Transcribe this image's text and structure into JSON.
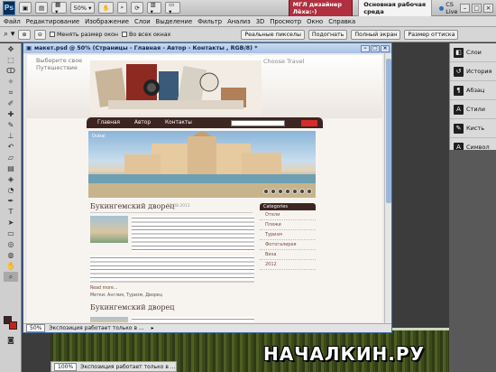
{
  "appbar": {
    "logo": "Ps",
    "zoom_value": "50%",
    "workspace_badge": "МГЛ дизайнер Лёха:-)",
    "workspace_main": "Основная рабочая среда",
    "cs_live": "CS Live",
    "minimize": "–",
    "maximize": "□",
    "close": "×"
  },
  "menu": [
    "Файл",
    "Редактирование",
    "Изображение",
    "Слои",
    "Выделение",
    "Фильтр",
    "Анализ",
    "3D",
    "Просмотр",
    "Окно",
    "Справка"
  ],
  "options": {
    "resize_windows": "Менять размер окон",
    "all_windows": "Во всех окнах",
    "actual_pixels": "Реальные пикселы",
    "fit": "Подогнать",
    "fill_screen": "Полный экран",
    "print_size": "Размер оттиска"
  },
  "panels": [
    {
      "icon": "layers-icon",
      "glyph": "◧",
      "label": "Слои"
    },
    {
      "icon": "history-icon",
      "glyph": "↺",
      "label": "История"
    },
    {
      "icon": "paragraph-icon",
      "glyph": "¶",
      "label": "Абзац"
    },
    {
      "icon": "styles-icon",
      "glyph": "A",
      "label": "Стили"
    },
    {
      "icon": "brush-icon",
      "glyph": "✎",
      "label": "Кисть"
    },
    {
      "icon": "character-icon",
      "glyph": "A",
      "label": "Символ"
    }
  ],
  "document": {
    "title": "макет.psd @ 50% (Страницы - Главная - Автор - Контакты , RGB/8) *",
    "zoom": "50%",
    "status": "Экспозиция работает только в ..."
  },
  "website": {
    "tagline": "Выберите свое Путешествие",
    "brand": "Choose Travel",
    "nav": [
      "Главная",
      "Автор",
      "Контакты"
    ],
    "hero_label": "Dubai",
    "heading": "Букингемский дворец",
    "date": "12.08.2012",
    "categories_title": "Categories",
    "categories": [
      "Отели",
      "Пляжи",
      "Туризм",
      "Фотогалерея",
      "Виза",
      "2012"
    ],
    "more": "Read more...",
    "tags": "Метки: Англия, Туризм, Дворец",
    "heading2": "Букингемский дворец"
  },
  "background": {
    "zoom": "100%",
    "status": "Экспозиция работает только в ...",
    "watermark": "НАЧАЛКИН.РУ"
  }
}
